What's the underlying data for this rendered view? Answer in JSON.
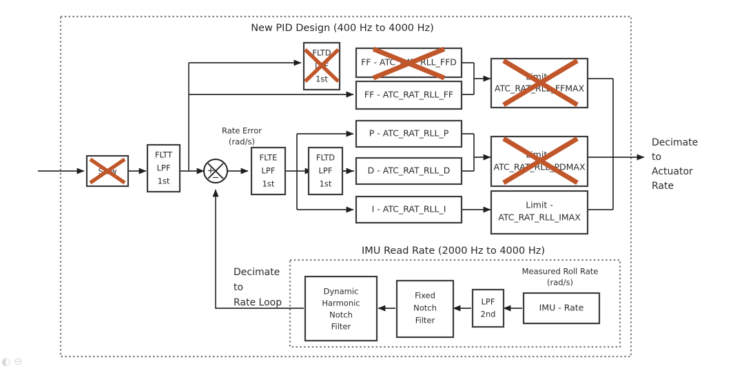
{
  "diagram": {
    "title_top": "New PID Design (400 Hz to 4000 Hz)",
    "title_bottom": "IMU Read Rate (2000 Hz to 4000 Hz)",
    "annotations": {
      "rate_error": "Rate Error",
      "rate_error_units": "(rad/s)",
      "measured_roll_rate": "Measured Roll Rate",
      "measured_roll_rate_units": "(rad/s)",
      "decimate_actuator_1": "Decimate",
      "decimate_actuator_2": "to",
      "decimate_actuator_3": "Actuator",
      "decimate_actuator_4": "Rate",
      "decimate_rate_loop_1": "Decimate",
      "decimate_rate_loop_2": "to",
      "decimate_rate_loop_3": "Rate Loop"
    },
    "sum_junction": {
      "plus": "+",
      "minus": "−"
    },
    "blocks": {
      "slew": {
        "label": "Slew",
        "crossed_out": true
      },
      "fltt": {
        "line1": "FLTT",
        "line2": "LPF",
        "line3": "1st",
        "crossed_out": false
      },
      "flte": {
        "line1": "FLTE",
        "line2": "LPF",
        "line3": "1st",
        "crossed_out": false
      },
      "fltd_mid": {
        "line1": "FLTD",
        "line2": "LPF",
        "line3": "1st",
        "crossed_out": false
      },
      "fltd_top": {
        "line1": "FLTD",
        "line2": "LPF",
        "line3": "1st",
        "crossed_out": true
      },
      "ffd": {
        "label": "FF - ATC_RAT_RLL_FFD",
        "crossed_out": true
      },
      "ff": {
        "label": "FF - ATC_RAT_RLL_FF",
        "crossed_out": false
      },
      "p": {
        "label": "P - ATC_RAT_RLL_P",
        "crossed_out": false
      },
      "d": {
        "label": "D - ATC_RAT_RLL_D",
        "crossed_out": false
      },
      "i": {
        "label": "I - ATC_RAT_RLL_I",
        "crossed_out": false
      },
      "ffmax": {
        "line1": "Limit -",
        "line2": "ATC_RAT_RLL_FFMAX",
        "crossed_out": true
      },
      "pdmax": {
        "line1": "Limit -",
        "line2": "ATC_RAT_RLL_PDMAX",
        "crossed_out": true
      },
      "imax": {
        "line1": "Limit -",
        "line2": "ATC_RAT_RLL_IMAX",
        "crossed_out": false
      },
      "dynamic_notch": {
        "line1": "Dynamic",
        "line2": "Harmonic",
        "line3": "Notch",
        "line4": "Filter",
        "crossed_out": false
      },
      "fixed_notch": {
        "line1": "Fixed",
        "line2": "Notch",
        "line3": "Filter",
        "crossed_out": false
      },
      "lpf2nd": {
        "line1": "LPF",
        "line2": "2nd",
        "crossed_out": false
      },
      "imu_rate": {
        "label": "IMU - Rate",
        "crossed_out": false
      }
    },
    "colors": {
      "strikethrough": "#c0562a",
      "block_stroke": "#3a3a3a",
      "wire": "#2b2b2b",
      "dotted_boundary": "#7d7d7d",
      "text": "#2a2a2a",
      "background": "#ffffff"
    }
  }
}
